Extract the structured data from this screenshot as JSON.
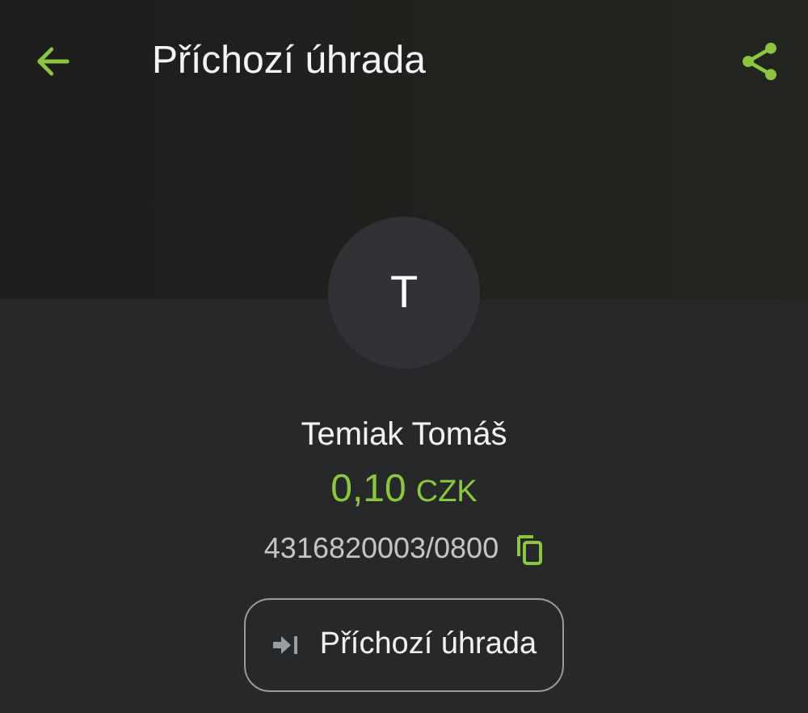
{
  "header": {
    "title": "Příchozí úhrada"
  },
  "avatar": {
    "initial": "T"
  },
  "counterparty": {
    "name": "Temiak Tomáš",
    "amount": "0,10",
    "currency": "CZK",
    "account": "4316820003/0800"
  },
  "type_chip": {
    "label": "Příchozí úhrada"
  }
}
